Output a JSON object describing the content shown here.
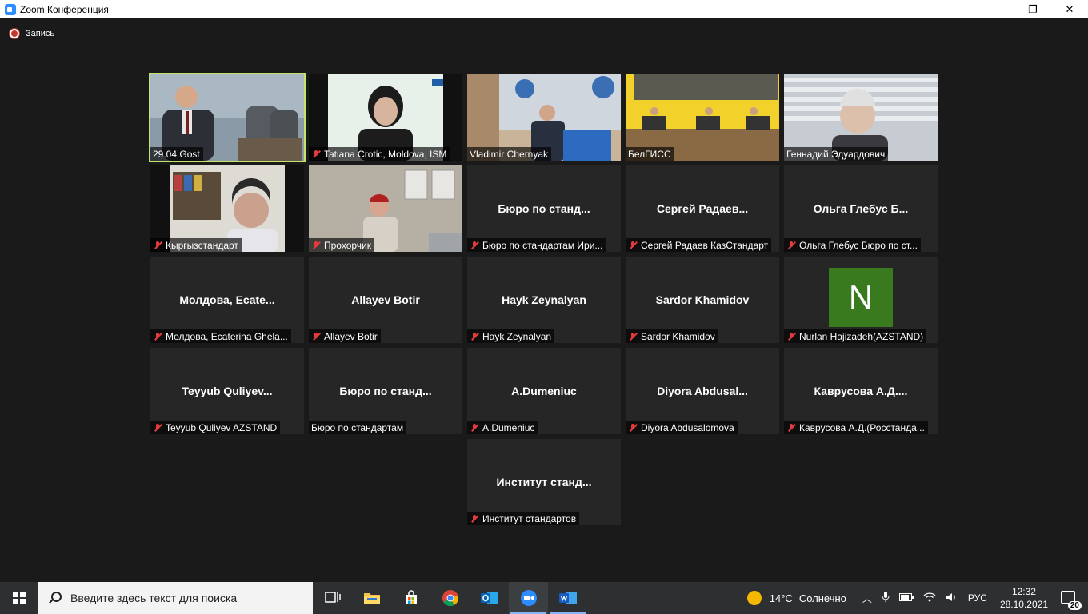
{
  "window": {
    "title": "Zoom Конференция",
    "minimize": "—",
    "maximize": "❐",
    "close": "✕"
  },
  "recording": {
    "label": "Запись"
  },
  "tiles": [
    {
      "row": 0,
      "col": 0,
      "kind": "video",
      "big": "",
      "name": "29.04 Gost",
      "muted": false,
      "active": true
    },
    {
      "row": 0,
      "col": 1,
      "kind": "video",
      "big": "",
      "name": "Tatiana Crotic, Moldova, ISM",
      "muted": true,
      "active": false
    },
    {
      "row": 0,
      "col": 2,
      "kind": "video",
      "big": "",
      "name": "Vladimir Chernyak",
      "muted": false,
      "active": false
    },
    {
      "row": 0,
      "col": 3,
      "kind": "video",
      "big": "",
      "name": "БелГИСС",
      "muted": false,
      "active": false
    },
    {
      "row": 0,
      "col": 4,
      "kind": "video",
      "big": "",
      "name": "Геннадий Эдуардович",
      "muted": false,
      "active": false
    },
    {
      "row": 1,
      "col": 0,
      "kind": "video",
      "big": "",
      "name": "Кыргызстандарт",
      "muted": true,
      "active": false
    },
    {
      "row": 1,
      "col": 1,
      "kind": "video",
      "big": "",
      "name": "Прохорчик",
      "muted": true,
      "active": false
    },
    {
      "row": 1,
      "col": 2,
      "kind": "name",
      "big": "Бюро по станд...",
      "name": "Бюро по стандартам Ири...",
      "muted": true,
      "active": false
    },
    {
      "row": 1,
      "col": 3,
      "kind": "name",
      "big": "Сергей Радаев...",
      "name": "Сергей Радаев КазСтандарт",
      "muted": true,
      "active": false
    },
    {
      "row": 1,
      "col": 4,
      "kind": "name",
      "big": "Ольга Глебус Б...",
      "name": "Ольга Глебус Бюро по ст...",
      "muted": true,
      "active": false
    },
    {
      "row": 2,
      "col": 0,
      "kind": "name",
      "big": "Молдова, Ecate...",
      "name": "Молдова, Ecaterina Ghela...",
      "muted": true,
      "active": false
    },
    {
      "row": 2,
      "col": 1,
      "kind": "name",
      "big": "Allayev Botir",
      "name": "Allayev Botir",
      "muted": true,
      "active": false
    },
    {
      "row": 2,
      "col": 2,
      "kind": "name",
      "big": "Hayk Zeynalyan",
      "name": "Hayk Zeynalyan",
      "muted": true,
      "active": false
    },
    {
      "row": 2,
      "col": 3,
      "kind": "name",
      "big": "Sardor Khamidov",
      "name": "Sardor Khamidov",
      "muted": true,
      "active": false
    },
    {
      "row": 2,
      "col": 4,
      "kind": "avatar",
      "big": "N",
      "name": "Nurlan Hajizadeh(AZSTAND)",
      "muted": true,
      "active": false
    },
    {
      "row": 3,
      "col": 0,
      "kind": "name",
      "big": "Teyyub Quliyev...",
      "name": "Teyyub Quliyev AZSTAND",
      "muted": true,
      "active": false
    },
    {
      "row": 3,
      "col": 1,
      "kind": "name",
      "big": "Бюро по станд...",
      "name": "Бюро по стандартам",
      "muted": false,
      "active": false
    },
    {
      "row": 3,
      "col": 2,
      "kind": "name",
      "big": "A.Dumeniuc",
      "name": "A.Dumeniuc",
      "muted": true,
      "active": false
    },
    {
      "row": 3,
      "col": 3,
      "kind": "name",
      "big": "Diyora Abdusal...",
      "name": "Diyora Abdusalomova",
      "muted": true,
      "active": false
    },
    {
      "row": 3,
      "col": 4,
      "kind": "name",
      "big": "Каврусова А.Д....",
      "name": "Каврусова А.Д.(Росстанда...",
      "muted": true,
      "active": false
    },
    {
      "row": 4,
      "col": 2,
      "kind": "name",
      "big": "Институт станд...",
      "name": "Институт стандартов",
      "muted": true,
      "active": false
    }
  ],
  "taskbar": {
    "search_placeholder": "Введите здесь текст для поиска",
    "apps": [
      "task-view",
      "file-explorer",
      "store",
      "chrome",
      "outlook",
      "zoom",
      "word"
    ],
    "weather_temp": "14°C",
    "weather_text": "Солнечно",
    "lang": "РУС",
    "time": "12:32",
    "date": "28.10.2021",
    "notifications": "20"
  },
  "colors": {
    "active_speaker": "#c6e36a",
    "avatar_bg": "#3a7a1e",
    "muted_icon": "#e23b3b"
  }
}
